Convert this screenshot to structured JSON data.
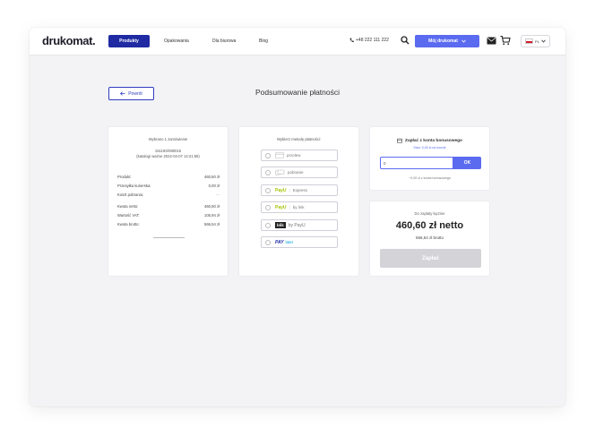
{
  "header": {
    "logo": "drukomat.",
    "nav": {
      "products": "Produkty",
      "packaging": "Opakowania",
      "office": "Dla biurowa",
      "blog": "Blog"
    },
    "phone": "+48 222 111 222",
    "account_label": "Mój drukomat",
    "language": "PL"
  },
  "page": {
    "back_label": "Powrót",
    "title": "Podsumowanie płatności"
  },
  "order_summary": {
    "selected_count": "Wybrano 1 zamówienie",
    "order_number": "15119S/080016",
    "catalog_date": "(katalogi ważne 2022-04-07 14:21:59)",
    "rows": [
      {
        "label": "Produkt:",
        "value": "460,60 zł"
      },
      {
        "label": "Przesyłka kurierska:",
        "value": "0,00 zł"
      },
      {
        "label": "Koszt pobrania:",
        "value": "—"
      },
      {
        "label": "Kwota netto:",
        "value": "460,60 zł"
      },
      {
        "label": "Wartość VAT:",
        "value": "105,94 zł"
      },
      {
        "label": "Kwota brutto:",
        "value": "566,54 zł"
      }
    ]
  },
  "payment_methods": {
    "title": "Wybierz metodę płatności:",
    "options": [
      {
        "id": "transfer",
        "label": "przelew"
      },
      {
        "id": "cod",
        "label": "pobranie"
      },
      {
        "id": "payu-express",
        "brand": "PayU",
        "label": "Express"
      },
      {
        "id": "payu-link",
        "brand": "PayU",
        "label": "by link"
      },
      {
        "id": "blik",
        "brand": "blik",
        "label": "by PayU"
      },
      {
        "id": "paylater",
        "brand": "PAY",
        "label": "later"
      }
    ]
  },
  "bonus": {
    "title": "Zapłać z konta bonusowego",
    "subtitle": "Stan: 0,00 zł na koncie",
    "input_value": "0",
    "ok_label": "OK",
    "note": "~0,00 zł z konta bonusowego"
  },
  "payment": {
    "label": "Do zapłaty łącznie",
    "net": "460,60 zł netto",
    "gross": "566,54 zł brutto",
    "pay_button": "Zapłać"
  }
}
